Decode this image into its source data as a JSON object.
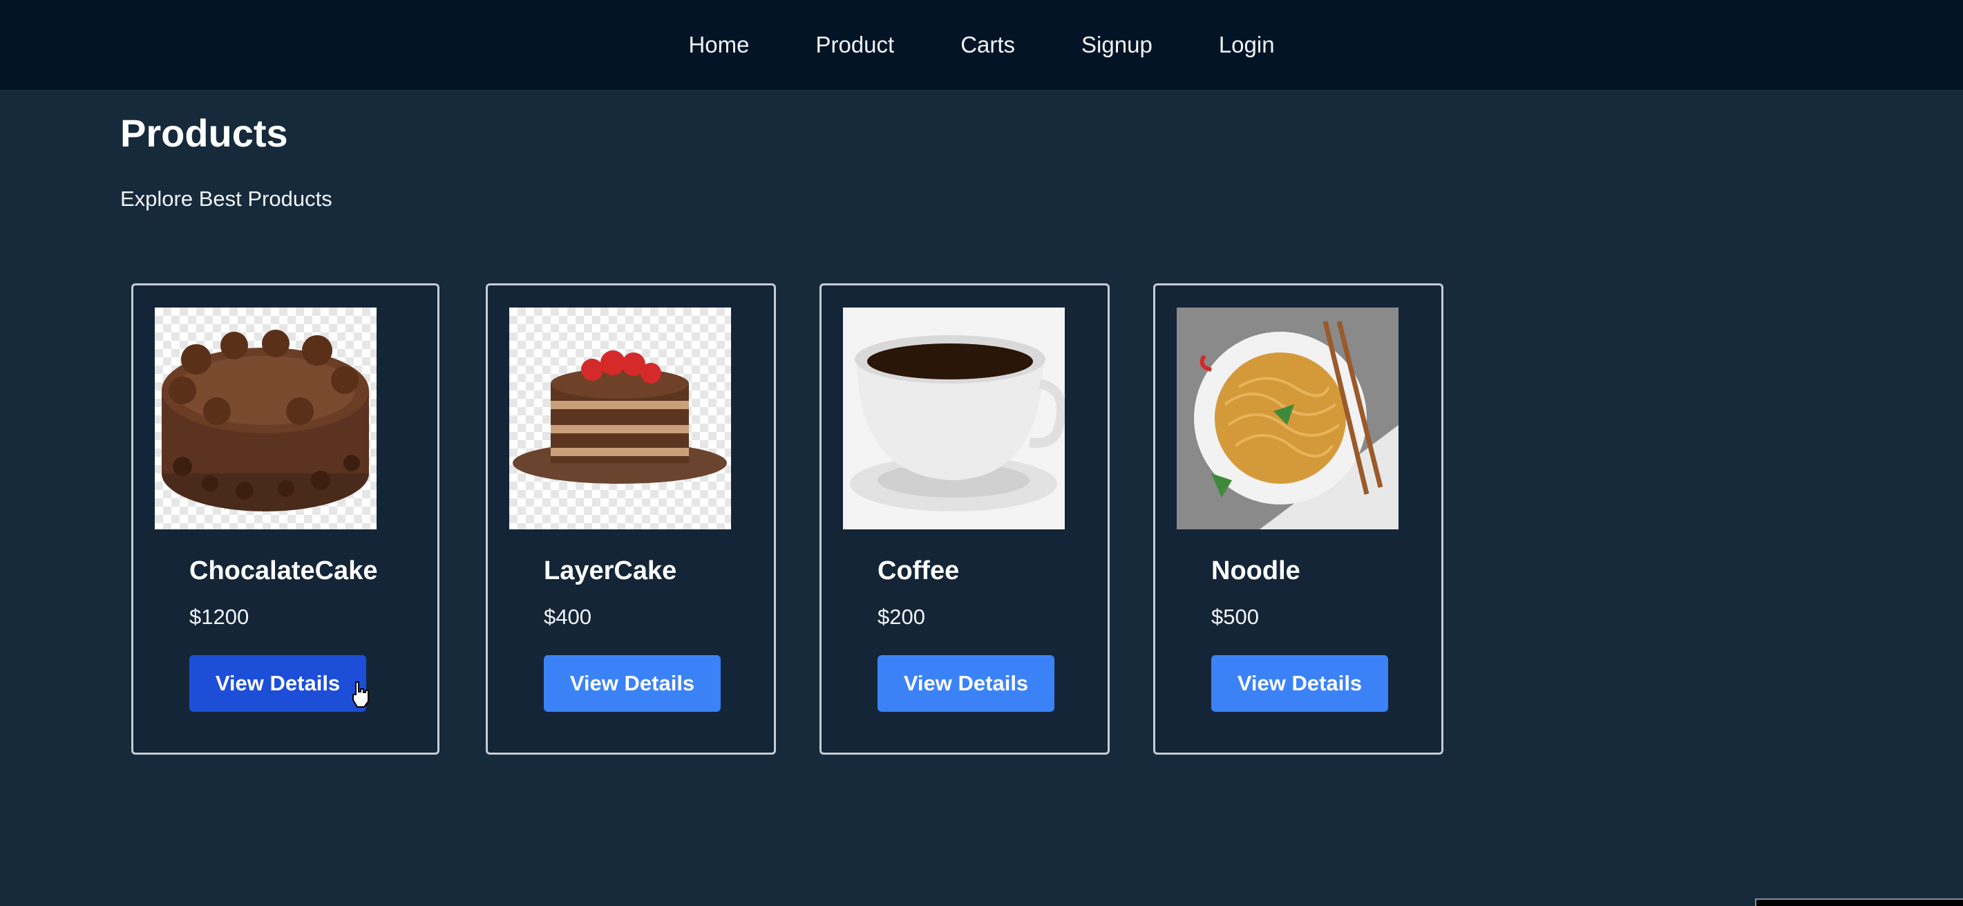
{
  "nav": {
    "items": [
      {
        "label": "Home"
      },
      {
        "label": "Product"
      },
      {
        "label": "Carts"
      },
      {
        "label": "Signup"
      },
      {
        "label": "Login"
      }
    ]
  },
  "page": {
    "title": "Products",
    "subtitle": "Explore Best Products"
  },
  "products": [
    {
      "name": "ChocalateCake",
      "price": "$1200",
      "button_label": "View Details",
      "image_icon": "chocolate-cake-image"
    },
    {
      "name": "LayerCake",
      "price": "$400",
      "button_label": "View Details",
      "image_icon": "layer-cake-image"
    },
    {
      "name": "Coffee",
      "price": "$200",
      "button_label": "View Details",
      "image_icon": "coffee-cup-image"
    },
    {
      "name": "Noodle",
      "price": "$500",
      "button_label": "View Details",
      "image_icon": "noodle-plate-image"
    }
  ],
  "colors": {
    "background": "#162a3c",
    "navbar": "#031426",
    "button": "#3b82f6",
    "button_active": "#1d4ed8",
    "card_border": "#c7ccd3"
  }
}
